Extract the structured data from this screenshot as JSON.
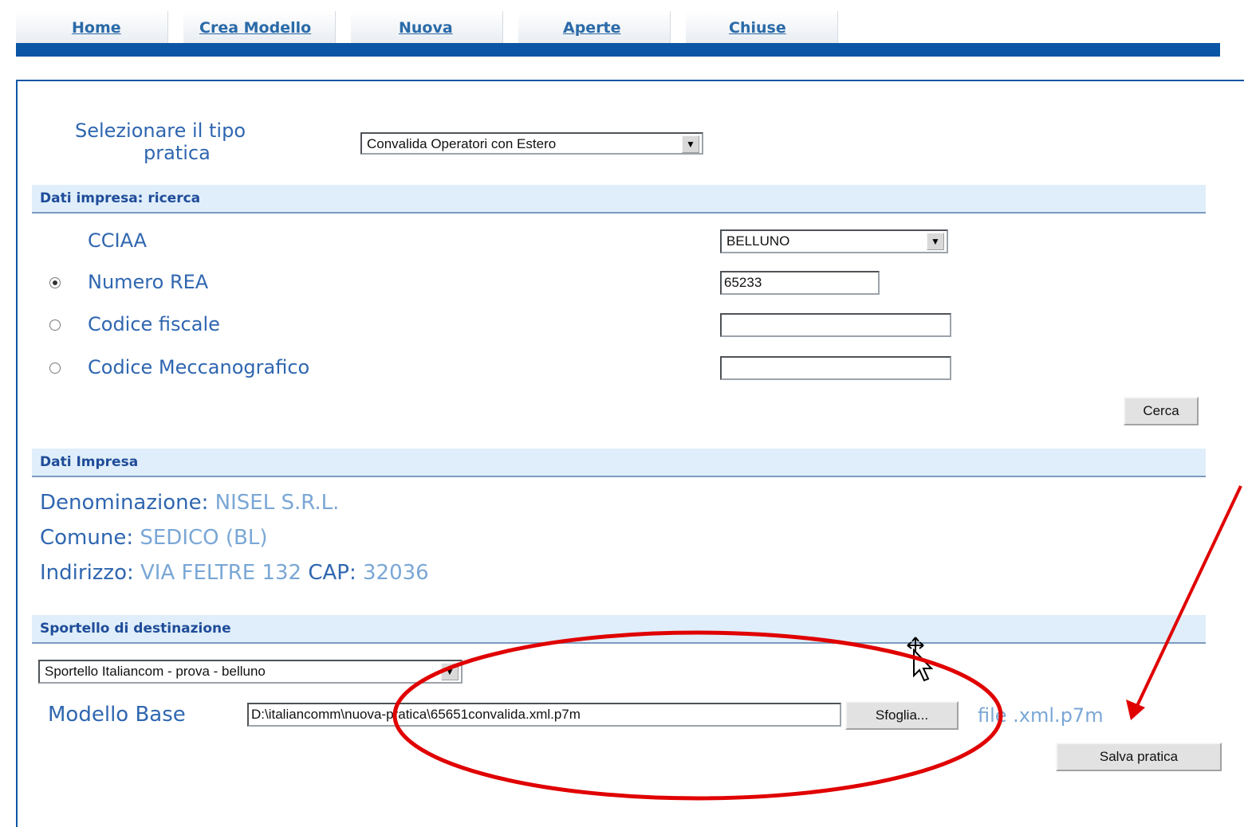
{
  "nav": {
    "tabs": [
      {
        "label": "Home"
      },
      {
        "label": "Crea Modello"
      },
      {
        "label": "Nuova"
      },
      {
        "label": "Aperte"
      },
      {
        "label": "Chiuse"
      }
    ]
  },
  "tipo_pratica": {
    "label_line1": "Selezionare il tipo",
    "label_line2": "pratica",
    "selected": "Convalida Operatori con Estero"
  },
  "ricerca": {
    "header": "Dati impresa: ricerca",
    "cciaa_label": "CCIAA",
    "cciaa_value": "BELLUNO",
    "numero_rea_label": "Numero REA",
    "numero_rea_value": "65233",
    "codice_fiscale_label": "Codice fiscale",
    "codice_fiscale_value": "",
    "codice_mecc_label": "Codice Meccanografico",
    "codice_mecc_value": "",
    "selected_radio": "numero_rea",
    "search_button": "Cerca"
  },
  "impresa": {
    "header": "Dati Impresa",
    "denominazione_label": "Denominazione:",
    "denominazione_value": "NISEL S.R.L.",
    "comune_label": "Comune:",
    "comune_value": "SEDICO  (BL)",
    "indirizzo_label": "Indirizzo:",
    "indirizzo_value": "VIA FELTRE 132",
    "cap_label": "CAP:",
    "cap_value": "32036"
  },
  "sportello": {
    "header": "Sportello di destinazione",
    "selected": "Sportello Italiancom - prova - belluno",
    "modello_label": "Modello Base",
    "modello_path": "D:\\italiancomm\\nuova-pratica\\65651convalida.xml.p7m",
    "browse_button": "Sfoglia...",
    "hint": "file .xml.p7m",
    "save_button": "Salva pratica"
  },
  "annotation_color": "#e00000"
}
